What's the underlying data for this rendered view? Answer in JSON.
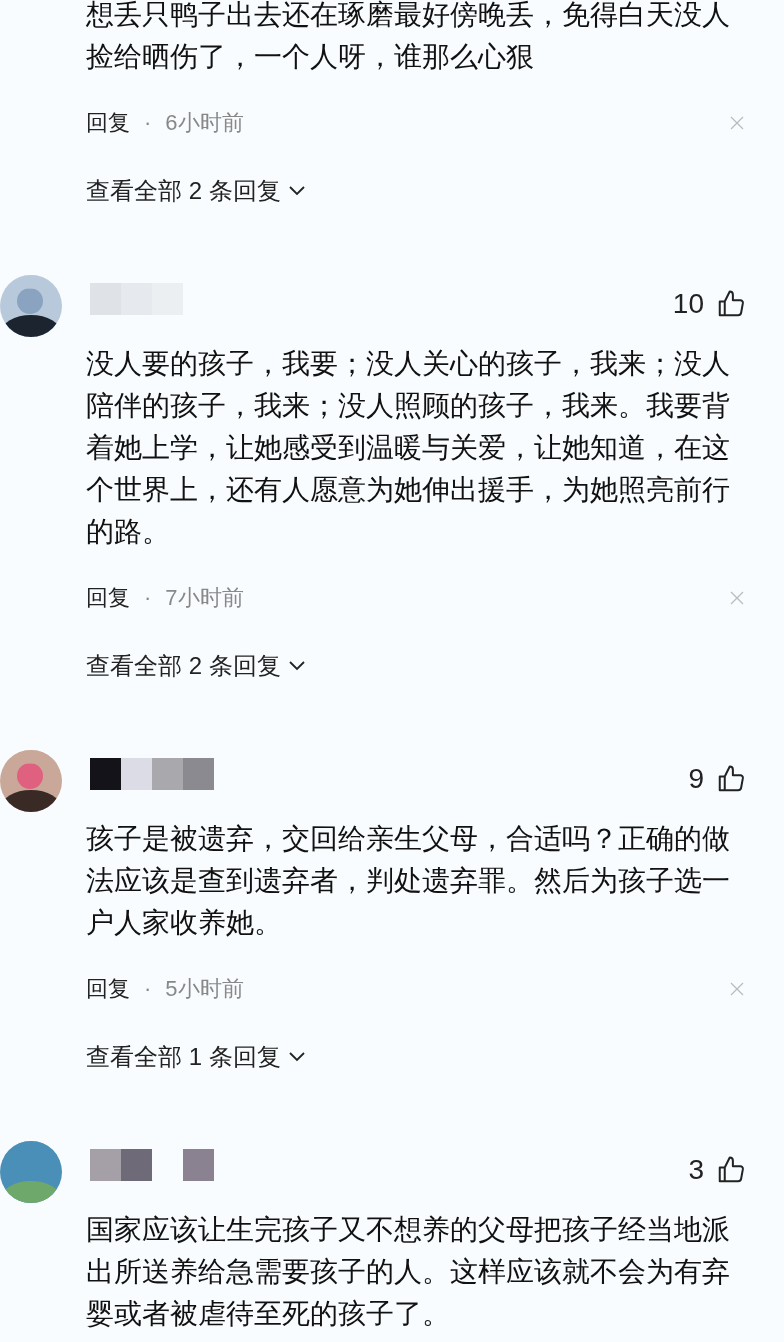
{
  "comments": [
    {
      "text": "想丢只鸭子出去还在琢磨最好傍晚丢，免得白天没人捡给晒伤了，一个人呀，谁那么心狠",
      "reply": "回复",
      "separator": "·",
      "time": "6小时前",
      "view_replies": "查看全部 2 条回复"
    },
    {
      "likes": "10",
      "text": "没人要的孩子，我要；没人关心的孩子，我来；没人陪伴的孩子，我来；没人照顾的孩子，我来。我要背着她上学，让她感受到温暖与关爱，让她知道，在这个世界上，还有人愿意为她伸出援手，为她照亮前行的路。",
      "reply": "回复",
      "separator": "·",
      "time": "7小时前",
      "view_replies": "查看全部 2 条回复"
    },
    {
      "likes": "9",
      "text": "孩子是被遗弃，交回给亲生父母，合适吗？正确的做法应该是查到遗弃者，判处遗弃罪。然后为孩子选一户人家收养她。",
      "reply": "回复",
      "separator": "·",
      "time": "5小时前",
      "view_replies": "查看全部 1 条回复"
    },
    {
      "likes": "3",
      "text": "国家应该让生完孩子又不想养的父母把孩子经当地派出所送养给急需要孩子的人。这样应该就不会为有弃婴或者被虐待至死的孩子了。"
    }
  ]
}
